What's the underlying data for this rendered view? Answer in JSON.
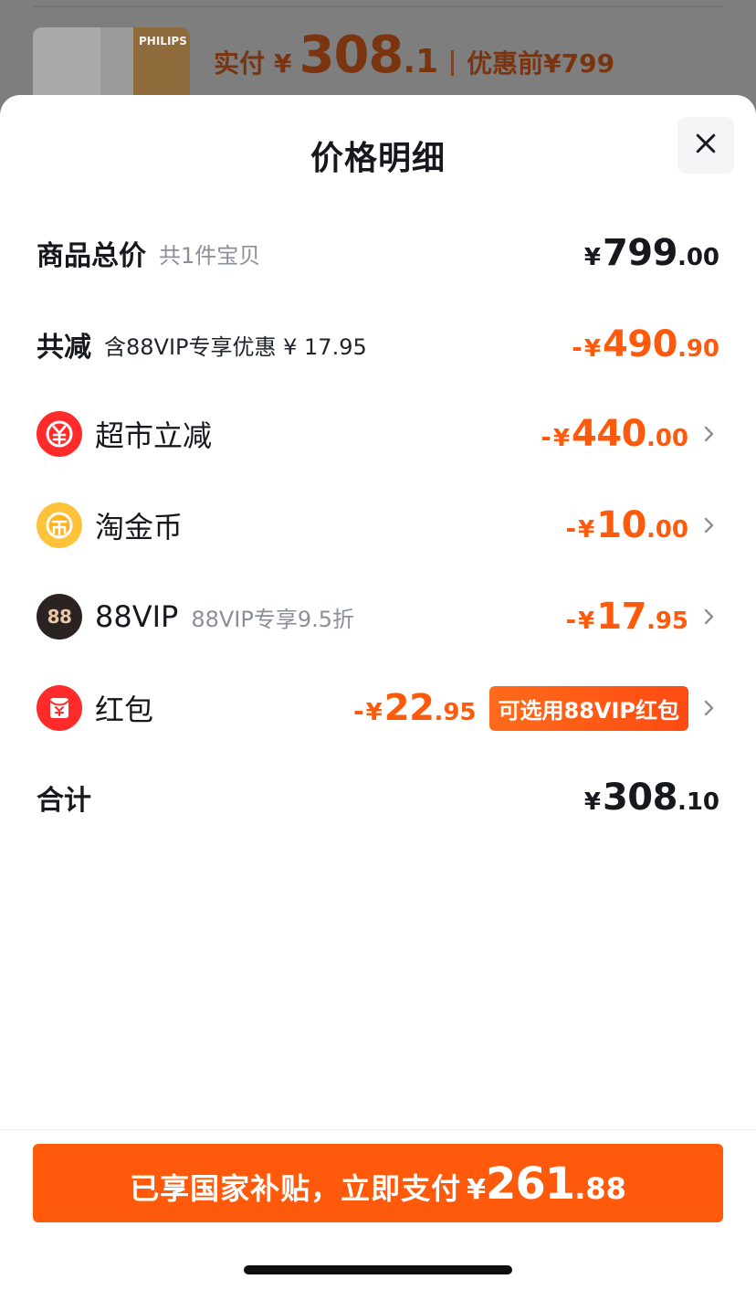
{
  "background": {
    "product_brand": "PHILIPS",
    "pay_label": "实付",
    "pay_currency": "¥",
    "pay_int": "308",
    "pay_dec": ".1",
    "before_label": "优惠前",
    "before_price": "¥799"
  },
  "sheet": {
    "title": "价格明细",
    "rows": {
      "total": {
        "label": "商品总价",
        "sub": "共1件宝贝",
        "amount": {
          "yen": "¥",
          "int": "799",
          "dec": ".00"
        }
      },
      "discount": {
        "label": "共减",
        "sub": "含88VIP专享优惠 ¥ 17.95",
        "amount": {
          "minus": "-",
          "yen": "¥",
          "int": "490",
          "dec": ".90"
        }
      },
      "supermarket": {
        "label": "超市立减",
        "amount": {
          "minus": "-",
          "yen": "¥",
          "int": "440",
          "dec": ".00"
        }
      },
      "coins": {
        "label": "淘金币",
        "amount": {
          "minus": "-",
          "yen": "¥",
          "int": "10",
          "dec": ".00"
        }
      },
      "vip": {
        "icon_text": "88",
        "label": "88VIP",
        "sub": "88VIP专享9.5折",
        "amount": {
          "minus": "-",
          "yen": "¥",
          "int": "17",
          "dec": ".95"
        }
      },
      "redpacket": {
        "label": "红包",
        "amount": {
          "minus": "-",
          "yen": "¥",
          "int": "22",
          "dec": ".95"
        },
        "pill": "可选用88VIP红包"
      },
      "sum": {
        "label": "合计",
        "amount": {
          "yen": "¥",
          "int": "308",
          "dec": ".10"
        }
      }
    },
    "pay_button": {
      "text": "已享国家补贴，立即支付",
      "yen": "¥",
      "int": "261",
      "dec": ".88"
    }
  },
  "colors": {
    "accent_orange": "#ff5a0b",
    "text_dark": "#16181d",
    "text_gray": "#8a8f99",
    "red": "#ff2b2b",
    "gold": "#ffc23b"
  }
}
